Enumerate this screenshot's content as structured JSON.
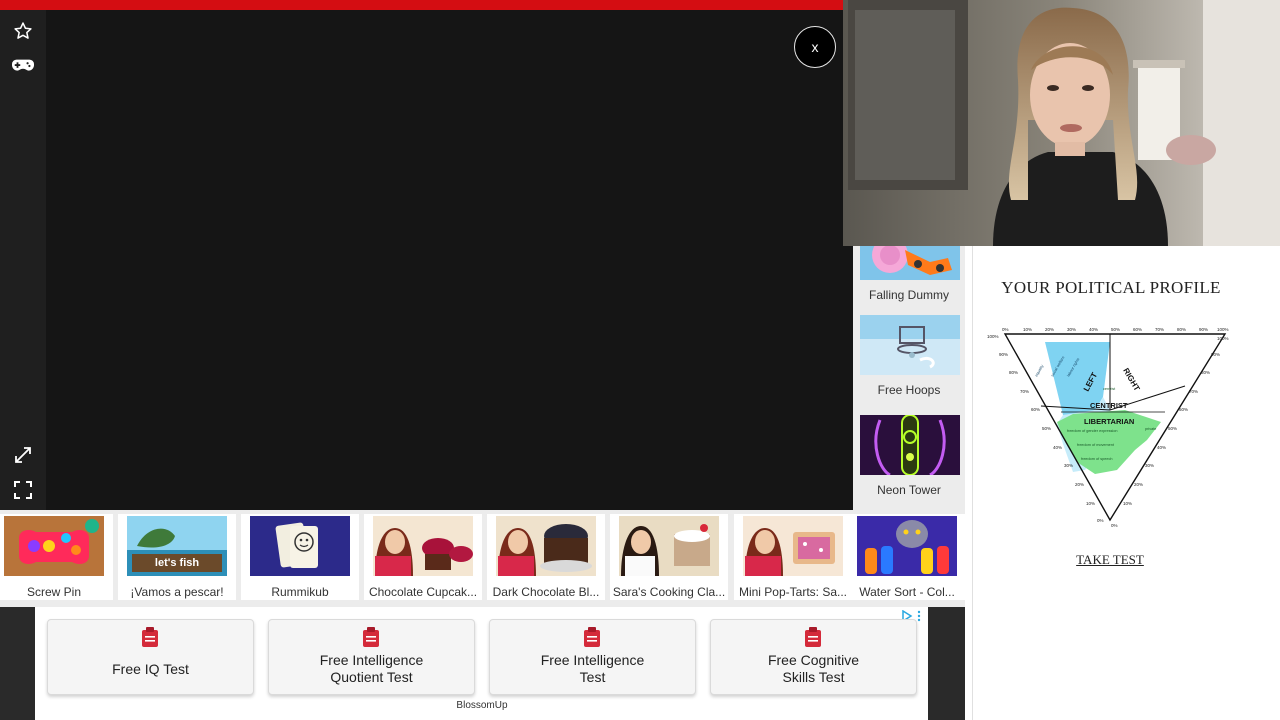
{
  "app": {
    "close_label": "x",
    "icons": [
      "star-icon",
      "gamepad-icon",
      "expand-icon",
      "fullscreen-icon",
      "close-icon",
      "ad-choices-icon",
      "clipboard-icon"
    ],
    "brand_color": "#d40d12"
  },
  "sidebar": {
    "games": [
      {
        "label": "Falling Dummy"
      },
      {
        "label": "Free Hoops"
      },
      {
        "label": "Neon Tower"
      }
    ]
  },
  "strip": {
    "games": [
      {
        "label": "Screw Pin"
      },
      {
        "label": "¡Vamos a pescar!"
      },
      {
        "label": "Rummikub"
      },
      {
        "label": "Chocolate Cupcak..."
      },
      {
        "label": "Dark Chocolate Bl..."
      },
      {
        "label": "Sara's Cooking Cla..."
      },
      {
        "label": "Mini Pop-Tarts: Sa..."
      },
      {
        "label": "Water Sort - Col..."
      }
    ],
    "thumb_text": {
      "fish": "let's fish"
    }
  },
  "ad": {
    "buttons": [
      {
        "line1": "Free IQ Test",
        "line2": ""
      },
      {
        "line1": "Free Intelligence",
        "line2": "Quotient Test"
      },
      {
        "line1": "Free Intelligence",
        "line2": "Test"
      },
      {
        "line1": "Free Cognitive",
        "line2": "Skills Test"
      }
    ],
    "brand": "BlossomUp"
  },
  "political": {
    "title": "YOUR POLITICAL PROFILE",
    "link": "TAKE TEST",
    "labels": {
      "left": "LEFT",
      "right": "RIGHT",
      "centrist": "CENTRIST",
      "libertarian": "LIBERTARIAN"
    },
    "top_ticks": [
      "0%",
      "10%",
      "20%",
      "30%",
      "40%",
      "50%",
      "60%",
      "70%",
      "80%",
      "90%",
      "100%"
    ],
    "left_ticks": [
      "100%",
      "90%",
      "80%",
      "70%",
      "60%",
      "50%",
      "40%",
      "30%",
      "20%",
      "10%",
      "0%"
    ],
    "right_ticks": [
      "0%",
      "10%",
      "20%",
      "30%",
      "40%",
      "50%",
      "60%",
      "70%",
      "80%",
      "90%",
      "100%"
    ],
    "lib_sub": [
      "freedom of gender expression",
      "freedom of movement",
      "freedom of speech"
    ],
    "left_sub": [
      "equality",
      "social welfare",
      "labour rights"
    ],
    "small_text": [
      "centrist",
      "private"
    ]
  }
}
